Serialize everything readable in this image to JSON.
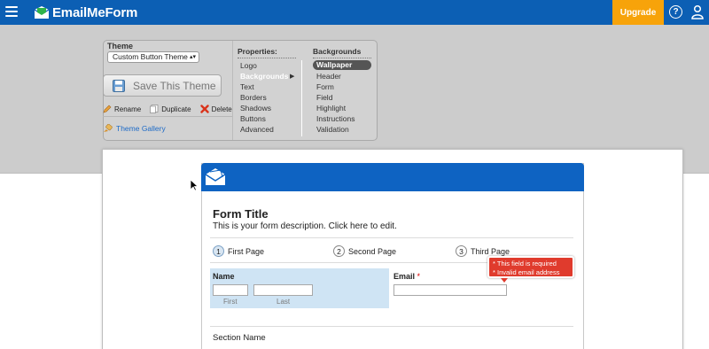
{
  "topbar": {
    "logo_text": "EmailMeForm",
    "upgrade_label": "Upgrade",
    "help_glyph": "?",
    "colors": {
      "bar": "#0c5fb4",
      "upgrade": "#f7a30a"
    }
  },
  "theme": {
    "label": "Theme",
    "selected": "Custom Button Theme",
    "save_label": "Save This Theme",
    "actions": {
      "rename": "Rename",
      "duplicate": "Duplicate",
      "delete": "Delete"
    },
    "gallery": "Theme Gallery"
  },
  "properties": {
    "heading": "Properties:",
    "items": [
      "Logo",
      "Backgrounds",
      "Text",
      "Borders",
      "Shadows",
      "Buttons",
      "Advanced"
    ],
    "active": "Backgrounds"
  },
  "backgrounds": {
    "heading": "Backgrounds",
    "items": [
      "Wallpaper",
      "Header",
      "Form",
      "Field",
      "Highlight",
      "Instructions",
      "Validation"
    ],
    "active": "Wallpaper"
  },
  "form": {
    "title": "Form Title",
    "description": "This is your form description. Click here to edit.",
    "pages": [
      {
        "num": "1",
        "label": "First Page"
      },
      {
        "num": "2",
        "label": "Second Page"
      },
      {
        "num": "3",
        "label": "Third Page"
      }
    ],
    "name_label": "Name",
    "first_sublabel": "First",
    "last_sublabel": "Last",
    "email_label": "Email",
    "required_mark": "*",
    "tooltip": [
      "* This field is required",
      "* Invalid email address"
    ],
    "section_name": "Section Name",
    "colors": {
      "header": "#0e63c2",
      "highlight": "#cfe4f4",
      "error": "#e03b2d"
    }
  }
}
